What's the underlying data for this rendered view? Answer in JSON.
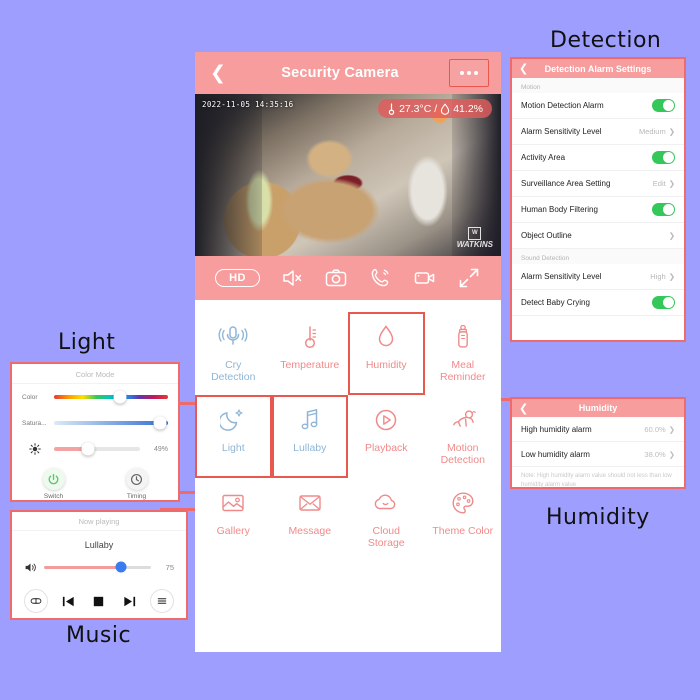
{
  "theme": {
    "background": "#9e9eff",
    "accent_pink": "#f79d9d",
    "highlight_red": "#e8584f",
    "toggle_green": "#34c759",
    "label_blue": "#8fb6d6",
    "label_pink": "#f08a8a"
  },
  "annotations": [
    {
      "id": "detection",
      "text": "Detection"
    },
    {
      "id": "light",
      "text": "Light"
    },
    {
      "id": "music",
      "text": "Music"
    },
    {
      "id": "humidity",
      "text": "Humidity"
    }
  ],
  "phone": {
    "header": {
      "back_icon": "chevron-left-icon",
      "title": "Security Camera",
      "more_icon": "more-options-icon"
    },
    "video": {
      "timestamp": "2022-11-05  14:35:16",
      "temperature": "27.3°C",
      "separator": "/",
      "humidity": "41.2%",
      "temp_icon": "thermometer-icon",
      "humidity_icon": "water-drop-icon",
      "watermark": "WATKINS",
      "watermark_mark": "W"
    },
    "video_toolbar": [
      {
        "name": "hd-quality-button",
        "label": "HD",
        "icon": "hd-badge"
      },
      {
        "name": "mute-button",
        "label": "",
        "icon": "speaker-mute-icon"
      },
      {
        "name": "snapshot-button",
        "label": "",
        "icon": "camera-icon"
      },
      {
        "name": "talk-button",
        "label": "",
        "icon": "phone-call-icon"
      },
      {
        "name": "record-button",
        "label": "",
        "icon": "video-camera-icon"
      },
      {
        "name": "fullscreen-button",
        "label": "",
        "icon": "fullscreen-icon"
      }
    ],
    "features": [
      [
        {
          "name": "cry-detection",
          "label": "Cry\nDetection",
          "icon": "cry-detection-icon",
          "color": "blue",
          "selected": false
        },
        {
          "name": "temperature",
          "label": "Temperature",
          "icon": "thermometer-icon",
          "color": "pink",
          "selected": false
        },
        {
          "name": "humidity",
          "label": "Humidity",
          "icon": "water-drop-icon",
          "color": "pink",
          "selected": true
        },
        {
          "name": "meal-reminder",
          "label": "Meal\nReminder",
          "icon": "baby-bottle-icon",
          "color": "pink",
          "selected": false
        }
      ],
      [
        {
          "name": "light",
          "label": "Light",
          "icon": "moon-star-icon",
          "color": "blue",
          "selected": true
        },
        {
          "name": "lullaby",
          "label": "Lullaby",
          "icon": "music-note-icon",
          "color": "blue",
          "selected": true
        },
        {
          "name": "playback",
          "label": "Playback",
          "icon": "play-circle-icon",
          "color": "pink",
          "selected": false
        },
        {
          "name": "motion-detection",
          "label": "Motion\nDetection",
          "icon": "crawling-baby-icon",
          "color": "pink",
          "selected": false
        }
      ],
      [
        {
          "name": "gallery",
          "label": "Gallery",
          "icon": "photo-icon",
          "color": "pink",
          "selected": false
        },
        {
          "name": "message",
          "label": "Message",
          "icon": "envelope-icon",
          "color": "pink",
          "selected": false
        },
        {
          "name": "cloud-storage",
          "label": "Cloud\nStorage",
          "icon": "cloud-icon",
          "color": "pink",
          "selected": false
        },
        {
          "name": "theme-color",
          "label": "Theme Color",
          "icon": "palette-icon",
          "color": "pink",
          "selected": false
        }
      ]
    ]
  },
  "detection_panel": {
    "header": {
      "back_icon": "chevron-left-icon",
      "title": "Detection Alarm Settings"
    },
    "sections": [
      {
        "heading": "Motion",
        "rows": [
          {
            "name": "motion-detection-alarm",
            "label": "Motion Detection Alarm",
            "control": "toggle",
            "state": "on",
            "value": ""
          },
          {
            "name": "motion-alarm-sensitivity",
            "label": "Alarm Sensitivity Level",
            "control": "value",
            "state": "",
            "value": "Medium"
          },
          {
            "name": "activity-area",
            "label": "Activity Area",
            "control": "toggle",
            "state": "on",
            "value": ""
          },
          {
            "name": "surveillance-area-setting",
            "label": "Surveillance Area Setting",
            "control": "value",
            "state": "",
            "value": "Edit"
          },
          {
            "name": "human-body-filtering",
            "label": "Human Body Filtering",
            "control": "toggle",
            "state": "on",
            "value": ""
          },
          {
            "name": "object-outline",
            "label": "Object Outline",
            "control": "value",
            "state": "",
            "value": ""
          }
        ]
      },
      {
        "heading": "Sound Detection",
        "rows": [
          {
            "name": "sound-alarm-sensitivity",
            "label": "Alarm Sensitivity Level",
            "control": "value",
            "state": "",
            "value": "High"
          },
          {
            "name": "detect-baby-crying",
            "label": "Detect Baby Crying",
            "control": "toggle",
            "state": "on",
            "value": ""
          }
        ]
      }
    ]
  },
  "humidity_panel": {
    "header": {
      "back_icon": "chevron-left-icon",
      "title": "Humidity"
    },
    "rows": [
      {
        "name": "high-humidity-alarm",
        "label": "High humidity alarm",
        "value": "60.0%"
      },
      {
        "name": "low-humidity-alarm",
        "label": "Low humidity alarm",
        "value": "38.0%"
      }
    ],
    "note": "Note: High humidity alarm value should not less than low humidity alarm value"
  },
  "light_panel": {
    "title": "Color Mode",
    "sliders": [
      {
        "name": "color-slider",
        "label": "Color",
        "percent": 58,
        "display": ""
      },
      {
        "name": "saturation-slider",
        "label": "Satura...",
        "percent": 93,
        "display": ""
      },
      {
        "name": "brightness-slider",
        "label": "",
        "icon": "brightness-icon",
        "percent": 40,
        "display": "49%"
      }
    ],
    "buttons": [
      {
        "name": "light-switch-button",
        "label": "Switch",
        "icon": "power-icon"
      },
      {
        "name": "light-timing-button",
        "label": "Timing",
        "icon": "clock-icon"
      }
    ]
  },
  "music_panel": {
    "title": "Now playing",
    "song": "Lullaby",
    "volume": {
      "name": "volume-slider",
      "icon": "speaker-icon",
      "value": "75",
      "percent": 72
    },
    "controls": [
      {
        "name": "repeat-mode-button",
        "icon": "repeat-icon"
      },
      {
        "name": "previous-track-button",
        "icon": "previous-track-icon"
      },
      {
        "name": "stop-button",
        "icon": "stop-icon"
      },
      {
        "name": "next-track-button",
        "icon": "next-track-icon"
      },
      {
        "name": "playlist-button",
        "icon": "playlist-icon"
      }
    ]
  }
}
